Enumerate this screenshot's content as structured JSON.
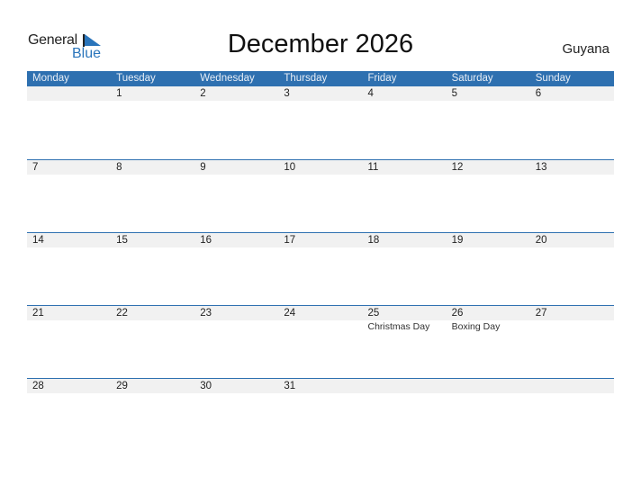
{
  "logo": {
    "line1": "General",
    "line2": "Blue"
  },
  "title": "December 2026",
  "country": "Guyana",
  "colors": {
    "header": "#2e70b0",
    "brand": "#2a75bb",
    "day_band": "#f1f1f1"
  },
  "weekdays": [
    "Monday",
    "Tuesday",
    "Wednesday",
    "Thursday",
    "Friday",
    "Saturday",
    "Sunday"
  ],
  "weeks": [
    [
      {
        "d": ""
      },
      {
        "d": "1"
      },
      {
        "d": "2"
      },
      {
        "d": "3"
      },
      {
        "d": "4"
      },
      {
        "d": "5"
      },
      {
        "d": "6"
      }
    ],
    [
      {
        "d": "7"
      },
      {
        "d": "8"
      },
      {
        "d": "9"
      },
      {
        "d": "10"
      },
      {
        "d": "11"
      },
      {
        "d": "12"
      },
      {
        "d": "13"
      }
    ],
    [
      {
        "d": "14"
      },
      {
        "d": "15"
      },
      {
        "d": "16"
      },
      {
        "d": "17"
      },
      {
        "d": "18"
      },
      {
        "d": "19"
      },
      {
        "d": "20"
      }
    ],
    [
      {
        "d": "21"
      },
      {
        "d": "22"
      },
      {
        "d": "23"
      },
      {
        "d": "24"
      },
      {
        "d": "25",
        "h": "Christmas Day"
      },
      {
        "d": "26",
        "h": "Boxing Day"
      },
      {
        "d": "27"
      }
    ],
    [
      {
        "d": "28"
      },
      {
        "d": "29"
      },
      {
        "d": "30"
      },
      {
        "d": "31"
      },
      {
        "d": ""
      },
      {
        "d": ""
      },
      {
        "d": ""
      }
    ]
  ]
}
